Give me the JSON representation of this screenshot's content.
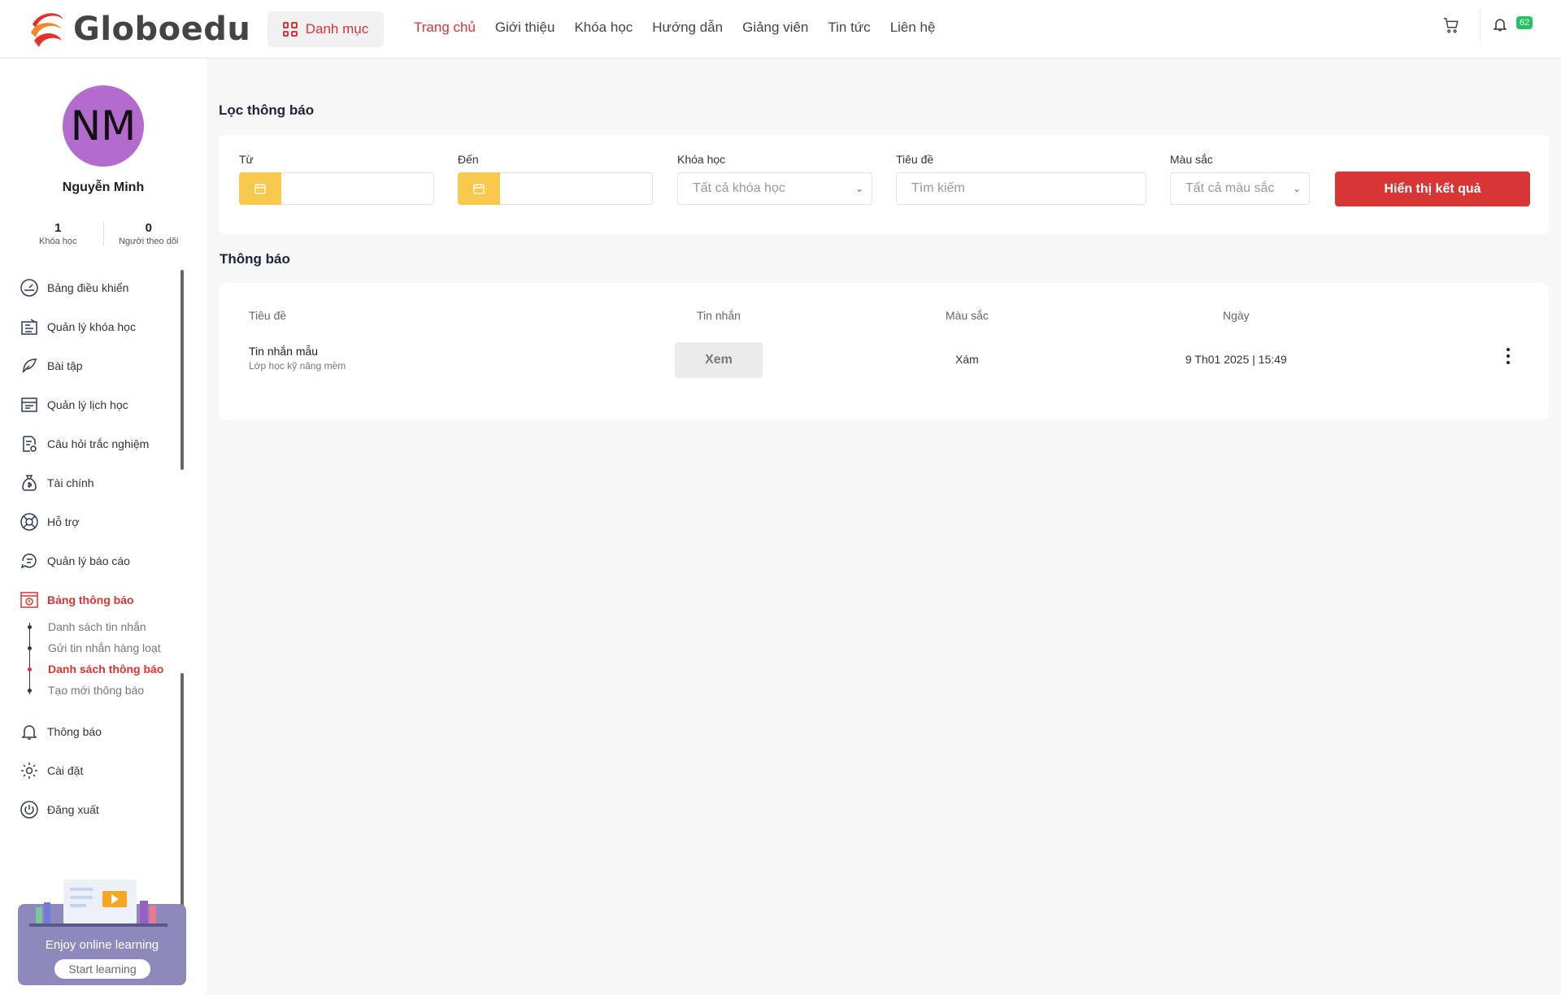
{
  "header": {
    "brand": "Globoedu",
    "category_label": "Danh mục",
    "nav": [
      "Trang chủ",
      "Giới thiệu",
      "Khóa học",
      "Hướng dẫn",
      "Giảng viên",
      "Tin tức",
      "Liên hệ"
    ],
    "notification_count": "62"
  },
  "profile": {
    "initials": "NM",
    "name": "Nguyễn Minh",
    "courses_count": "1",
    "courses_label": "Khóa học",
    "followers_count": "0",
    "followers_label": "Người theo dõi"
  },
  "menu": [
    {
      "label": "Bảng điều khiển",
      "icon": "dashboard-icon"
    },
    {
      "label": "Quản lý khóa học",
      "icon": "course-icon"
    },
    {
      "label": "Bài tập",
      "icon": "feather-icon"
    },
    {
      "label": "Quản lý lịch học",
      "icon": "schedule-icon"
    },
    {
      "label": "Câu hỏi trắc nghiệm",
      "icon": "quiz-icon"
    },
    {
      "label": "Tài chính",
      "icon": "money-bag-icon"
    },
    {
      "label": "Hỗ trợ",
      "icon": "lifebuoy-icon"
    },
    {
      "label": "Quản lý báo cáo",
      "icon": "chat-icon"
    },
    {
      "label": "Bảng thông báo",
      "icon": "board-icon"
    }
  ],
  "submenu": [
    "Danh sách tin nhắn",
    "Gửi tin nhắn hàng loạt",
    "Danh sách thông báo",
    "Tạo mới thông báo"
  ],
  "menu_bottom": [
    {
      "label": "Thông báo",
      "icon": "bell-icon"
    },
    {
      "label": "Cài đặt",
      "icon": "gear-icon"
    },
    {
      "label": "Đăng xuất",
      "icon": "power-icon"
    }
  ],
  "promo": {
    "title": "Enjoy online learning",
    "button": "Start learning"
  },
  "filter": {
    "heading": "Lọc thông báo",
    "from_label": "Từ",
    "to_label": "Đến",
    "course_label": "Khóa học",
    "course_value": "Tất cả khóa học",
    "title_label": "Tiêu đề",
    "title_placeholder": "Tìm kiếm",
    "color_label": "Màu sắc",
    "color_value": "Tất cả màu sắc",
    "submit": "Hiển thị kết quả"
  },
  "notices": {
    "heading": "Thông báo",
    "columns": [
      "Tiêu đề",
      "Tin nhắn",
      "Màu sắc",
      "Ngày"
    ],
    "rows": [
      {
        "title": "Tin nhắn mẫu",
        "subtitle": "Lớp học kỹ năng mềm",
        "message_btn": "Xem",
        "color": "Xám",
        "date": "9 Th01 2025 | 15:49"
      }
    ]
  },
  "colors": {
    "accent": "#d83535",
    "calendar": "#f8c94c",
    "badge": "#22c55e",
    "avatar": "#b36bcd"
  }
}
